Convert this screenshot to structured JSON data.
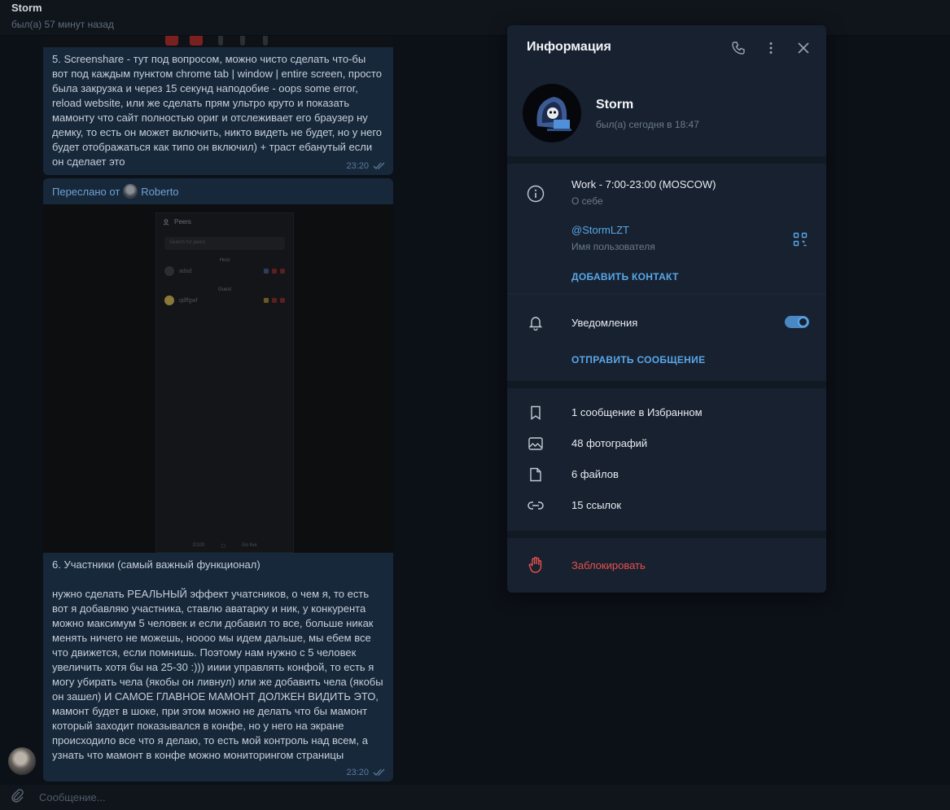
{
  "chat": {
    "name": "Storm",
    "status": "был(а) 57 минут назад"
  },
  "messages": [
    {
      "text": "5. Screenshare - тут под вопросом, можно чисто сделать что-бы вот под каждым пунктом chrome tab | window | entire screen, просто была закрузка и через 15 секунд наподобие - oops some error, reload website, или же сделать прям ультро круто и показать мамонту что сайт полностью ориг и отслеживает его браузер ну демку, то есть он может включить, никто видеть не будет, но у него будет отображаться как типо он включил) + траст ебанутый если он сделает это",
      "time": "23:20"
    },
    {
      "text": "6. Участники (самый важный функционал)\n\nнужно сделать РЕАЛЬНЫЙ эффект учатсников, о чем я, то есть вот я добавляю участника, ставлю аватарку и ник, у конкурента можно максимум 5 человек и если добавил то все, больше никак менять ничего не можешь, ноооо мы идем дальше, мы ебем все что движется, если помнишь. Поэтому нам нужно с 5 человек увеличить хотя бы на 25-30 :))) ииии управлять конфой, то есть я могу убирать чела (якобы он ливнул) или же добавить чела (якобы он зашел) И САМОЕ ГЛАВНОЕ МАМОНТ ДОЛЖЕН ВИДИТЬ ЭТО, мамонт будет в шоке, при этом можно не делать что бы мамонт который заходит показывался в конфе, но у него на экране происходило все что я делаю, то есть мой контроль над всем, а узнать что мамонт в конфе можно мониторингом страницы",
      "time": "23:20"
    }
  ],
  "forwarded": {
    "prefix": "Переслано от",
    "from": "Roberto",
    "screenshot": {
      "title": "Peers",
      "search_placeholder": "Search for peers",
      "host_label": "Host",
      "host_name": "adsd",
      "guest_label": "Guest",
      "guest_name": "qdffgwf",
      "footer_count": "2/100",
      "footer_live": "Go live"
    }
  },
  "composer": {
    "placeholder": "Сообщение..."
  },
  "panel": {
    "title": "Информация",
    "contact_name": "Storm",
    "contact_status": "был(а) сегодня в 18:47",
    "bio": "Work - 7:00-23:00 (MOSCOW)",
    "bio_label": "О себе",
    "username": "@StormLZT",
    "username_label": "Имя пользователя",
    "add_contact": "ДОБАВИТЬ КОНТАКТ",
    "notifications": "Уведомления",
    "notifications_on": true,
    "send_message": "ОТПРАВИТЬ СООБЩЕНИЕ",
    "media": [
      {
        "icon": "bookmark-icon",
        "label": "1 сообщение в Избранном"
      },
      {
        "icon": "photo-icon",
        "label": "48 фотографий"
      },
      {
        "icon": "file-icon",
        "label": "6 файлов"
      },
      {
        "icon": "link-icon",
        "label": "15 ссылок"
      }
    ],
    "block": "Заблокировать"
  },
  "colors": {
    "accent": "#5aa7e8",
    "danger": "#e8514d",
    "panel_bg": "#172130",
    "bubble_bg": "#17283b"
  }
}
